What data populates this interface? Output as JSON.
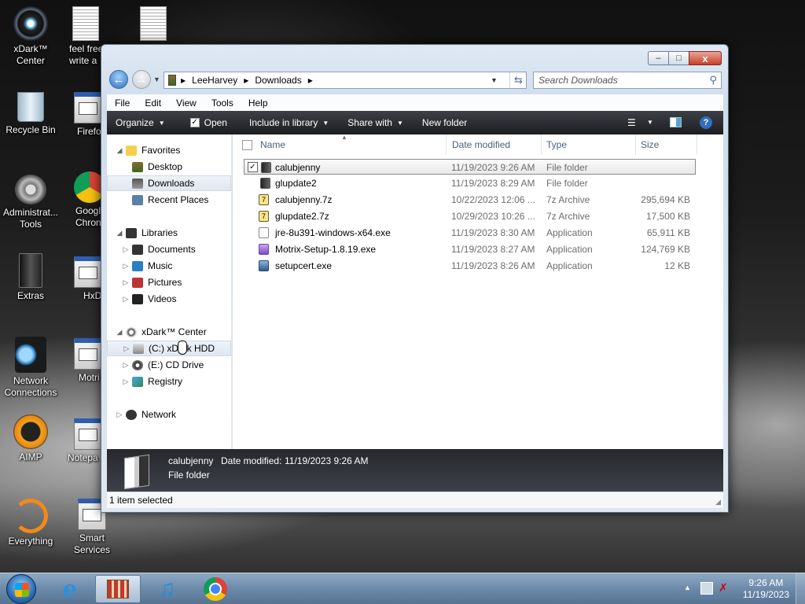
{
  "desktop": {
    "icons": [
      {
        "label": "xDark™\nCenter"
      },
      {
        "label": "feel free\nwrite a"
      },
      {
        "label": "Recycle Bin"
      },
      {
        "label": "Firefo"
      },
      {
        "label": "Administrat...\nTools"
      },
      {
        "label": "Googl\nChron"
      },
      {
        "label": "Extras"
      },
      {
        "label": "HxD"
      },
      {
        "label": "Network\nConnections"
      },
      {
        "label": "Motri"
      },
      {
        "label": "AIMP"
      },
      {
        "label": "Notepa"
      },
      {
        "label": "Everything"
      },
      {
        "label": "Smart\nServices"
      }
    ]
  },
  "window": {
    "breadcrumb": [
      "LeeHarvey",
      "Downloads"
    ],
    "search_placeholder": "Search Downloads",
    "minimize": "–",
    "maximize": "□",
    "close": "x",
    "menu": [
      "File",
      "Edit",
      "View",
      "Tools",
      "Help"
    ],
    "commands": {
      "organize": "Organize",
      "open": "Open",
      "include": "Include in library",
      "share": "Share with",
      "new_folder": "New folder"
    },
    "nav": {
      "favorites": "Favorites",
      "desktop": "Desktop",
      "downloads": "Downloads",
      "recent": "Recent Places",
      "libraries": "Libraries",
      "documents": "Documents",
      "music": "Music",
      "pictures": "Pictures",
      "videos": "Videos",
      "computer": "xDark™ Center",
      "c_drive": "(C:) xDark HDD",
      "e_drive": "(E:) CD Drive",
      "registry": "Registry",
      "network": "Network"
    },
    "columns": {
      "name": "Name",
      "date": "Date modified",
      "type": "Type",
      "size": "Size"
    },
    "files": [
      {
        "name": "calubjenny",
        "date": "11/19/2023 9:26 AM",
        "type": "File folder",
        "size": ""
      },
      {
        "name": "glupdate2",
        "date": "11/19/2023 8:29 AM",
        "type": "File folder",
        "size": ""
      },
      {
        "name": "calubjenny.7z",
        "date": "10/22/2023 12:06 ...",
        "type": "7z Archive",
        "size": "295,694 KB"
      },
      {
        "name": "glupdate2.7z",
        "date": "10/29/2023 10:26 ...",
        "type": "7z Archive",
        "size": "17,500 KB"
      },
      {
        "name": "jre-8u391-windows-x64.exe",
        "date": "11/19/2023 8:30 AM",
        "type": "Application",
        "size": "65,911 KB"
      },
      {
        "name": "Motrix-Setup-1.8.19.exe",
        "date": "11/19/2023 8:27 AM",
        "type": "Application",
        "size": "124,769 KB"
      },
      {
        "name": "setupcert.exe",
        "date": "11/19/2023 8:26 AM",
        "type": "Application",
        "size": "12 KB"
      }
    ],
    "details": {
      "name": "calubjenny",
      "date_label": "Date modified:",
      "date": "11/19/2023 9:26 AM",
      "type": "File folder"
    },
    "status": "1 item selected"
  },
  "taskbar": {
    "time": "9:26 AM",
    "date": "11/19/2023"
  },
  "colors": {
    "cmdbar": "#2a2c31",
    "selection": "#e9e9e9",
    "taskbar": "#6d8aab"
  }
}
